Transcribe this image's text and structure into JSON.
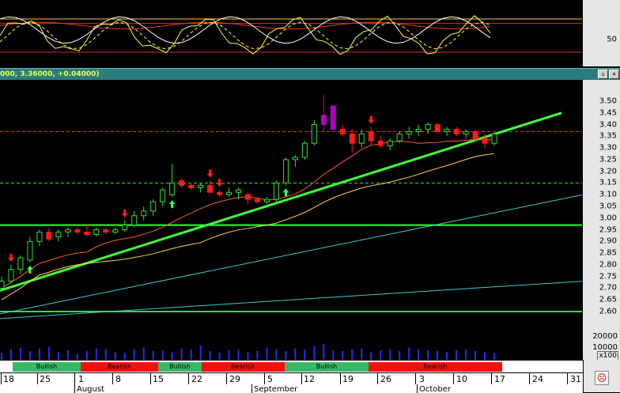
{
  "window": {
    "title": "000, 3.36000, +0.04000)",
    "controls": [
      "restore-icon",
      "close-icon"
    ]
  },
  "oscillator": {
    "y_tick": "50",
    "levels": {
      "upper": 80,
      "mid": 50,
      "lower": 20
    }
  },
  "volume": {
    "y_ticks": [
      "20000",
      "10000"
    ],
    "unit": "x100"
  },
  "signals": [
    {
      "label": "",
      "type": "bearish"
    },
    {
      "label": "Bullish",
      "type": "bullish"
    },
    {
      "label": "Bearish",
      "type": "bearish"
    },
    {
      "label": "Bullish",
      "type": "bullish"
    },
    {
      "label": "Bearish",
      "type": "bearish"
    },
    {
      "label": "",
      "type": "bearish"
    },
    {
      "label": "Bullish",
      "type": "bullish"
    },
    {
      "label": "Bearish",
      "type": "bearish"
    }
  ],
  "dates": {
    "days": [
      "18",
      "25",
      "1",
      "8",
      "15",
      "22",
      "29",
      "5",
      "12",
      "19",
      "26",
      "3",
      "10",
      "17",
      "24",
      "31"
    ],
    "months": [
      "August",
      "September",
      "October"
    ]
  },
  "chart_data": {
    "type": "candlestick",
    "y_ticks": [
      "3.50",
      "3.45",
      "3.40",
      "3.35",
      "3.30",
      "3.25",
      "3.20",
      "3.15",
      "3.10",
      "3.05",
      "3.00",
      "2.95",
      "2.90",
      "2.85",
      "2.80",
      "2.75",
      "2.70",
      "2.65",
      "2.60"
    ],
    "ylim": [
      2.56,
      3.55
    ],
    "horizontal_lines": [
      {
        "value": 3.37,
        "color": "#ff3030",
        "style": "dashed"
      },
      {
        "value": 3.15,
        "color": "#33dd33",
        "style": "dashed"
      },
      {
        "value": 2.97,
        "color": "#33ff33",
        "style": "solid"
      },
      {
        "value": 2.6,
        "color": "#33dd33",
        "style": "solid"
      }
    ],
    "candles": [
      [
        2.7,
        2.75,
        2.69,
        2.73
      ],
      [
        2.73,
        2.8,
        2.72,
        2.78
      ],
      [
        2.78,
        2.84,
        2.76,
        2.83
      ],
      [
        2.82,
        2.92,
        2.81,
        2.9
      ],
      [
        2.9,
        2.95,
        2.88,
        2.94
      ],
      [
        2.94,
        2.96,
        2.9,
        2.91
      ],
      [
        2.92,
        2.95,
        2.9,
        2.94
      ],
      [
        2.94,
        2.96,
        2.92,
        2.95
      ],
      [
        2.95,
        2.96,
        2.93,
        2.94
      ],
      [
        2.94,
        2.97,
        2.92,
        2.93
      ],
      [
        2.93,
        2.96,
        2.92,
        2.95
      ],
      [
        2.95,
        2.96,
        2.93,
        2.94
      ],
      [
        2.94,
        2.96,
        2.93,
        2.95
      ],
      [
        2.95,
        2.99,
        2.94,
        2.97
      ],
      [
        2.97,
        3.03,
        2.96,
        3.01
      ],
      [
        3.01,
        3.05,
        2.99,
        3.03
      ],
      [
        3.03,
        3.08,
        3.01,
        3.07
      ],
      [
        3.07,
        3.13,
        3.05,
        3.12
      ],
      [
        3.1,
        3.23,
        3.09,
        3.15
      ],
      [
        3.16,
        3.17,
        3.13,
        3.14
      ],
      [
        3.14,
        3.15,
        3.12,
        3.13
      ],
      [
        3.13,
        3.15,
        3.11,
        3.14
      ],
      [
        3.14,
        3.16,
        3.12,
        3.11
      ],
      [
        3.11,
        3.12,
        3.09,
        3.1
      ],
      [
        3.1,
        3.13,
        3.09,
        3.11
      ],
      [
        3.11,
        3.13,
        3.08,
        3.12
      ],
      [
        3.1,
        3.11,
        3.06,
        3.08
      ],
      [
        3.08,
        3.09,
        3.06,
        3.07
      ],
      [
        3.07,
        3.09,
        3.06,
        3.08
      ],
      [
        3.08,
        3.16,
        3.07,
        3.15
      ],
      [
        3.15,
        3.26,
        3.14,
        3.25
      ],
      [
        3.25,
        3.27,
        3.22,
        3.26
      ],
      [
        3.26,
        3.33,
        3.25,
        3.32
      ],
      [
        3.32,
        3.42,
        3.31,
        3.4
      ],
      [
        3.4,
        3.53,
        3.37,
        3.44
      ],
      [
        3.48,
        3.48,
        3.38,
        3.38
      ],
      [
        3.38,
        3.4,
        3.35,
        3.36
      ],
      [
        3.36,
        3.38,
        3.28,
        3.32
      ],
      [
        3.32,
        3.38,
        3.3,
        3.36
      ],
      [
        3.37,
        3.39,
        3.31,
        3.33
      ],
      [
        3.33,
        3.35,
        3.3,
        3.31
      ],
      [
        3.31,
        3.34,
        3.29,
        3.33
      ],
      [
        3.33,
        3.37,
        3.32,
        3.36
      ],
      [
        3.36,
        3.39,
        3.34,
        3.37
      ],
      [
        3.37,
        3.4,
        3.35,
        3.38
      ],
      [
        3.38,
        3.41,
        3.36,
        3.4
      ],
      [
        3.4,
        3.41,
        3.36,
        3.37
      ],
      [
        3.37,
        3.39,
        3.35,
        3.38
      ],
      [
        3.38,
        3.39,
        3.35,
        3.36
      ],
      [
        3.36,
        3.38,
        3.34,
        3.37
      ],
      [
        3.37,
        3.38,
        3.33,
        3.34
      ],
      [
        3.34,
        3.36,
        3.3,
        3.32
      ],
      [
        3.32,
        3.36,
        3.31,
        3.36
      ]
    ]
  }
}
